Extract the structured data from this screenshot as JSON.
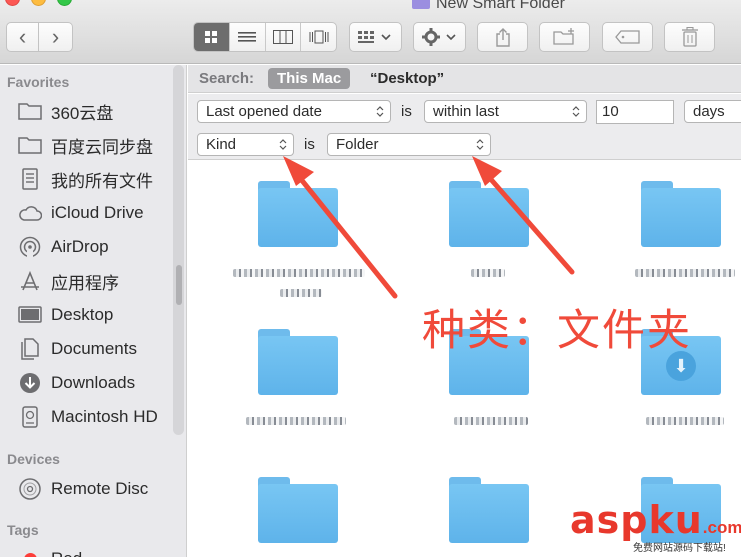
{
  "window": {
    "title": "New Smart Folder"
  },
  "toolbar": {
    "back": "‹",
    "forward": "›",
    "views": [
      "icon-view",
      "list-view",
      "column-view",
      "cover-flow-view"
    ],
    "arrange": "arrange",
    "action": "action",
    "share": "share",
    "new_folder": "new-folder",
    "tags": "tags",
    "trash": "trash"
  },
  "sidebar": {
    "favorites_heading": "Favorites",
    "favorites": [
      {
        "label": "360云盘",
        "icon": "folder-icon"
      },
      {
        "label": "百度云同步盘",
        "icon": "folder-icon"
      },
      {
        "label": "我的所有文件",
        "icon": "all-files-icon"
      },
      {
        "label": "iCloud Drive",
        "icon": "cloud-icon"
      },
      {
        "label": "AirDrop",
        "icon": "airdrop-icon"
      },
      {
        "label": "应用程序",
        "icon": "applications-icon"
      },
      {
        "label": "Desktop",
        "icon": "desktop-icon"
      },
      {
        "label": "Documents",
        "icon": "documents-icon"
      },
      {
        "label": "Downloads",
        "icon": "downloads-icon"
      },
      {
        "label": "Macintosh HD",
        "icon": "hard-drive-icon"
      }
    ],
    "devices_heading": "Devices",
    "devices": [
      {
        "label": "Remote Disc",
        "icon": "disc-icon"
      }
    ],
    "tags_heading": "Tags",
    "tags": [
      {
        "label": "Red",
        "color": "#fc3d39"
      }
    ]
  },
  "search": {
    "label": "Search:",
    "scope_active": "This Mac",
    "scope_other": "“Desktop”"
  },
  "criteria": {
    "row1": {
      "attribute": "Last opened date",
      "connector": "is",
      "operator": "within last",
      "value": "10",
      "unit": "days"
    },
    "row2": {
      "attribute": "Kind",
      "connector": "is",
      "value": "Folder"
    }
  },
  "annotation": {
    "text": "种类：文件夹",
    "color": "#f04a3a"
  },
  "watermark": {
    "brand_a": "asp",
    "brand_b": "ku",
    "suffix": ".com",
    "tagline": "免费网站源码下载站!"
  },
  "colors": {
    "folder_blue": "#6ebbec",
    "accent_red": "#f04a3a"
  }
}
